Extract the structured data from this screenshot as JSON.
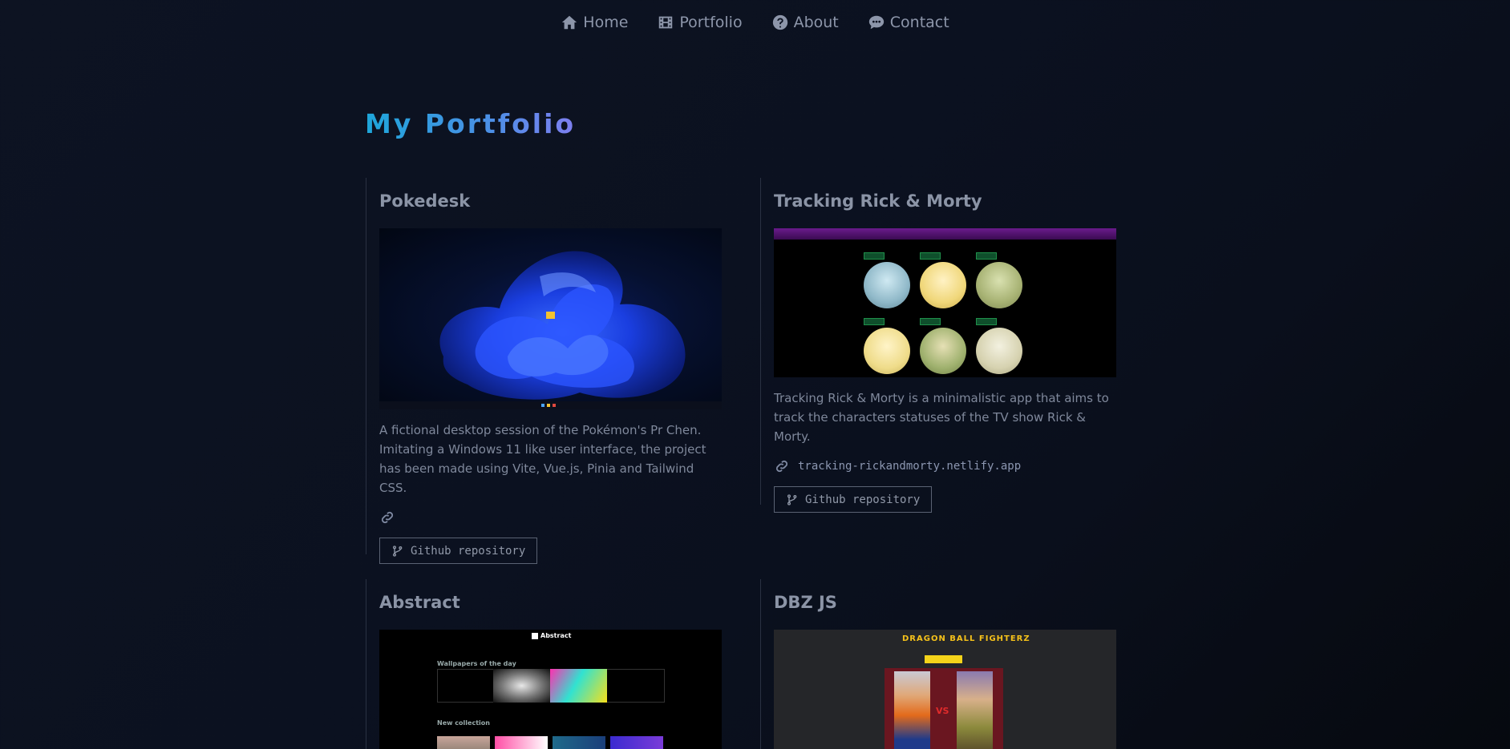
{
  "nav": {
    "items": [
      {
        "label": "Home",
        "icon": "home-icon"
      },
      {
        "label": "Portfolio",
        "icon": "film-icon"
      },
      {
        "label": "About",
        "icon": "question-circle-icon"
      },
      {
        "label": "Contact",
        "icon": "comment-icon"
      }
    ]
  },
  "page": {
    "title": "My Portfolio",
    "accent_start": "#1ea6da",
    "accent_end": "#7f7ff0"
  },
  "projects": [
    {
      "title": "Pokedesk",
      "description": "A fictional desktop session of the Pokémon's Pr Chen. Imitating a Windows 11 like user interface, the project has been made using Vite, Vue.js, Pinia and Tailwind CSS.",
      "link": "",
      "github_label": "Github repository"
    },
    {
      "title": "Tracking Rick & Morty",
      "description": "Tracking Rick & Morty is a minimalistic app that aims to track the characters statuses of the TV show Rick & Morty.",
      "link": "tracking-rickandmorty.netlify.app",
      "github_label": "Github repository"
    },
    {
      "title": "Abstract",
      "thumb_text": {
        "logo": "Abstract",
        "section1": "Wallpapers of the day",
        "section2": "New collection"
      }
    },
    {
      "title": "DBZ JS",
      "thumb_text": {
        "logo": "DRAGON BALL FIGHTERZ"
      }
    }
  ]
}
